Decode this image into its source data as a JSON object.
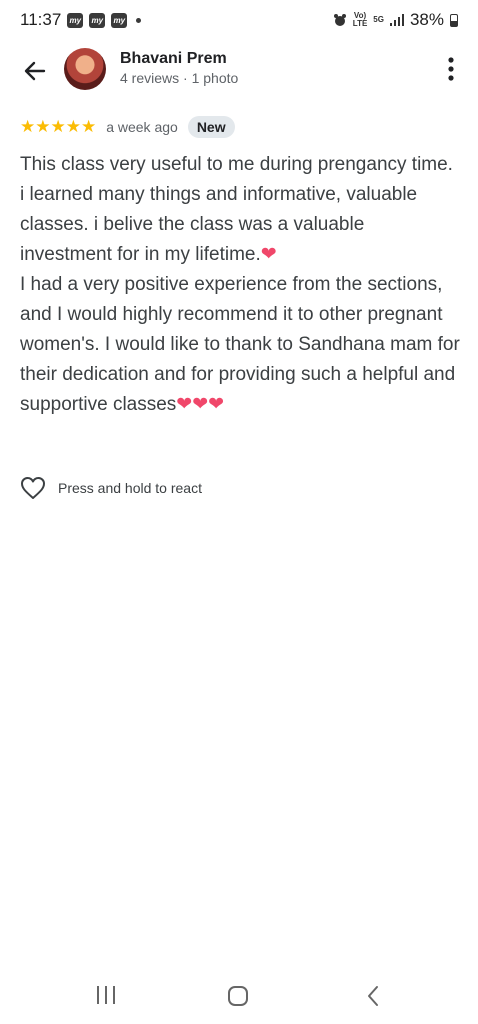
{
  "status_bar": {
    "time": "11:37",
    "notification_icons": [
      "my",
      "my",
      "my"
    ],
    "volte_label": "Vo)\nLTE",
    "network_label": "5G",
    "battery": "38%"
  },
  "header": {
    "reviewer_name": "Bhavani Prem",
    "reviewer_meta": "4 reviews · 1 photo"
  },
  "review": {
    "rating": 5,
    "stars": "★★★★★",
    "time_ago": "a week ago",
    "badge": "New",
    "paragraph1": "This class very useful to me during prengancy time. i learned many things and informative, valuable classes. i belive the class was a valuable investment for in my lifetime.",
    "paragraph1_emoji": "❤",
    "paragraph2": "I had a very positive experience from the sections, and I would highly recommend it to other pregnant women's. I would like to thank to Sandhana mam for their dedication and for providing such a helpful and supportive classes",
    "paragraph2_emoji": "❤❤❤"
  },
  "react": {
    "label": "Press and hold to react"
  },
  "colors": {
    "star": "#fbbc04",
    "heart": "#f0476a",
    "badge_bg": "#e3e8ec"
  }
}
